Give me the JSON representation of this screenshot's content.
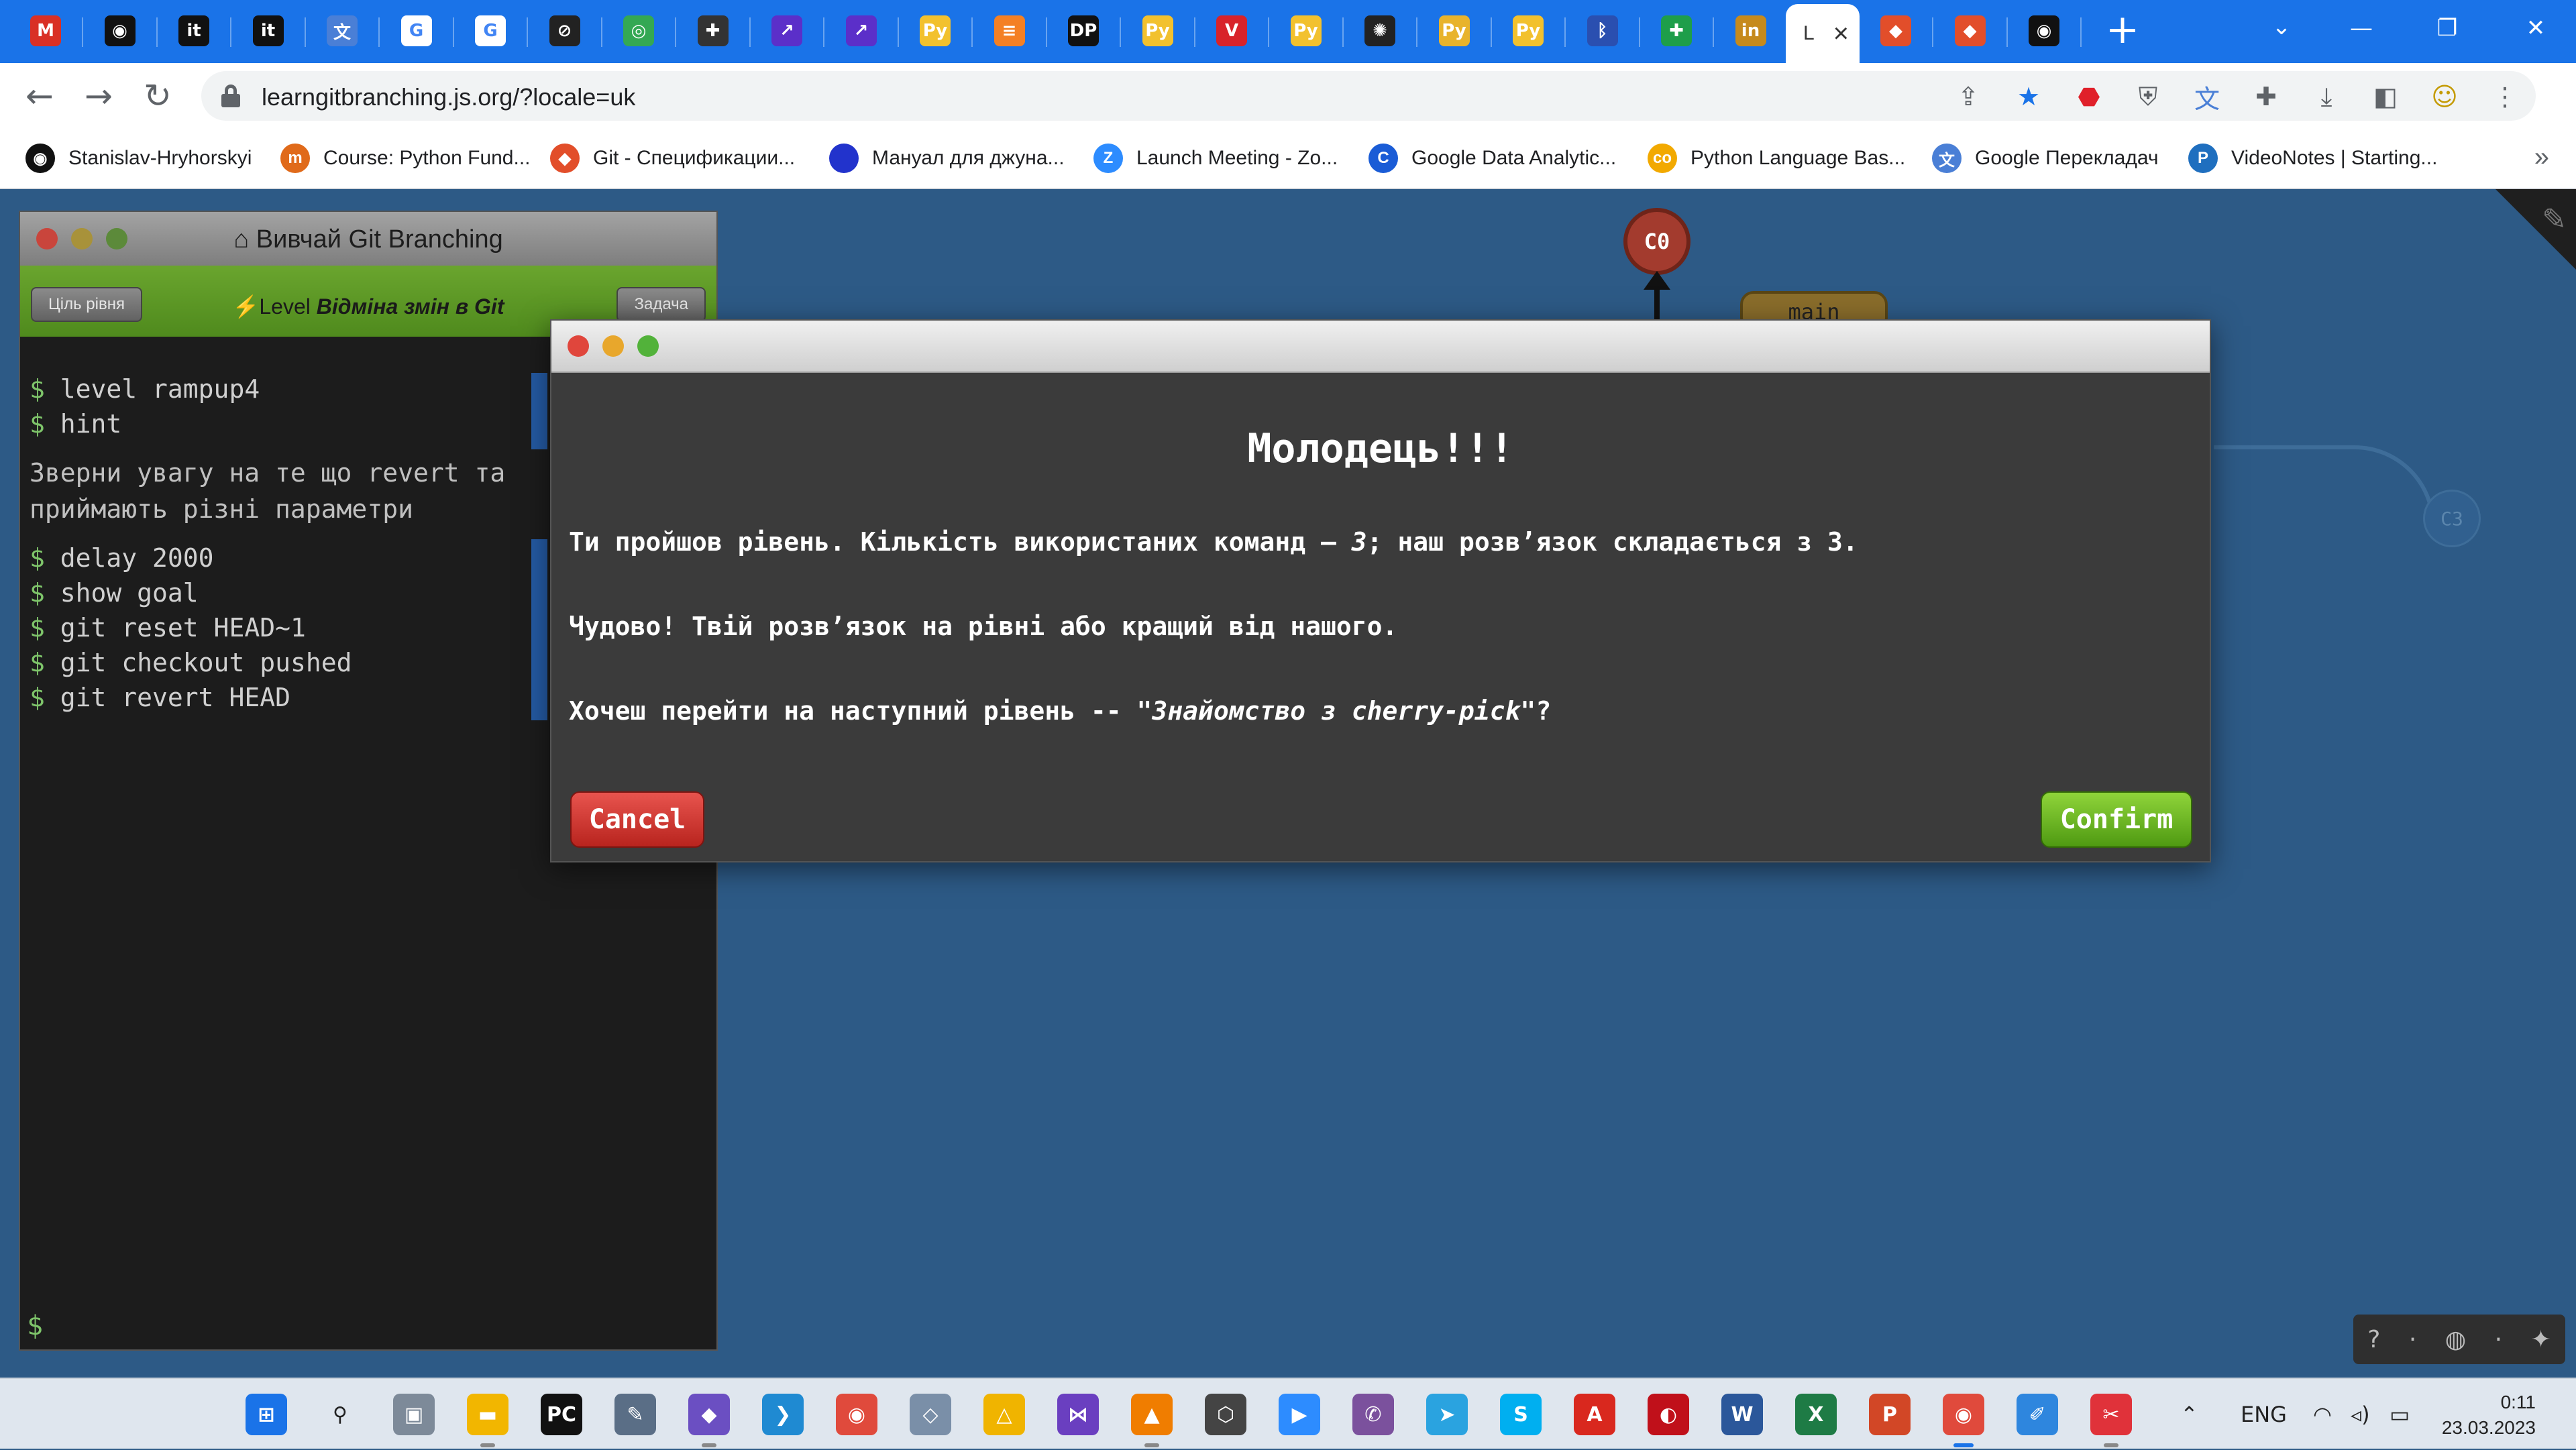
{
  "browser": {
    "tabs": [
      {
        "icon": "gmail-icon",
        "glyph": "M",
        "bg": "#d93025"
      },
      {
        "icon": "github-icon",
        "glyph": "◉",
        "bg": "#111111"
      },
      {
        "icon": "itproger-icon",
        "glyph": "it",
        "bg": "#111111"
      },
      {
        "icon": "itproger-icon",
        "glyph": "it",
        "bg": "#111111"
      },
      {
        "icon": "translate-icon",
        "glyph": "文",
        "bg": "#4a7fd6"
      },
      {
        "icon": "google-icon",
        "glyph": "G",
        "bg": "#ffffff"
      },
      {
        "icon": "google-icon",
        "glyph": "G",
        "bg": "#ffffff"
      },
      {
        "icon": "link-icon",
        "glyph": "⊘",
        "bg": "#222222"
      },
      {
        "icon": "chrome-web-icon",
        "glyph": "◎",
        "bg": "#34a853"
      },
      {
        "icon": "puzzle-icon",
        "glyph": "✚",
        "bg": "#333333"
      },
      {
        "icon": "visual-studio-icon",
        "glyph": "↗",
        "bg": "#5b2fc9"
      },
      {
        "icon": "visual-studio-icon",
        "glyph": "↗",
        "bg": "#5b2fc9"
      },
      {
        "icon": "python-icon",
        "glyph": "Py",
        "bg": "#f2c12e"
      },
      {
        "icon": "stackoverflow-icon",
        "glyph": "≡",
        "bg": "#f48024"
      },
      {
        "icon": "dp-icon",
        "glyph": "DP",
        "bg": "#111111"
      },
      {
        "icon": "python-icon",
        "glyph": "Py",
        "bg": "#f2c12e"
      },
      {
        "icon": "vivaldi-icon",
        "glyph": "V",
        "bg": "#d8232a"
      },
      {
        "icon": "python-icon",
        "glyph": "Py",
        "bg": "#f2c12e"
      },
      {
        "icon": "openai-icon",
        "glyph": "✺",
        "bg": "#222222"
      },
      {
        "icon": "python-icon",
        "glyph": "Py",
        "bg": "#e8b32c"
      },
      {
        "icon": "python-icon",
        "glyph": "Py",
        "bg": "#f2c12e"
      },
      {
        "icon": "bluetooth-icon",
        "glyph": "ᛒ",
        "bg": "#2a4fb0"
      },
      {
        "icon": "plus-cross-icon",
        "glyph": "✚",
        "bg": "#1e9e4a"
      },
      {
        "icon": "linkedin-icon",
        "glyph": "in",
        "bg": "#c68a1c"
      },
      {
        "icon": "git-icon",
        "glyph": "◆",
        "bg": "#e24e2a"
      },
      {
        "icon": "git-icon",
        "glyph": "◆",
        "bg": "#e24e2a"
      },
      {
        "icon": "github-icon",
        "glyph": "◉",
        "bg": "#111111"
      }
    ],
    "active_tab_label": "L",
    "new_tab": "+",
    "url": "learngitbranching.js.org/?locale=uk",
    "bookmarks": [
      {
        "label": "Stanislav-Hryhorskyi",
        "icon": "github-icon",
        "glyph": "◉",
        "color": "#111111"
      },
      {
        "label": "Course: Python Fund...",
        "icon": "course-icon",
        "glyph": "m",
        "color": "#e06a1a"
      },
      {
        "label": "Git - Спецификации...",
        "icon": "git-icon",
        "glyph": "◆",
        "color": "#e24e2a"
      },
      {
        "label": "Мануал для джуна...",
        "icon": "circle-icon",
        "glyph": "",
        "color": "#2233cc"
      },
      {
        "label": "Launch Meeting - Zo...",
        "icon": "zoom-icon",
        "glyph": "Z",
        "color": "#2d8cff"
      },
      {
        "label": "Google Data Analytic...",
        "icon": "coursera-icon",
        "glyph": "C",
        "color": "#1a5cd6"
      },
      {
        "label": "Python Language Bas...",
        "icon": "codecademy-icon",
        "glyph": "co",
        "color": "#f2a900"
      },
      {
        "label": "Google Перекладач",
        "icon": "translate-icon",
        "glyph": "文",
        "color": "#4a7fd6"
      },
      {
        "label": "VideoNotes | Starting...",
        "icon": "videonotes-icon",
        "glyph": "P",
        "color": "#1f6fbf"
      }
    ]
  },
  "terminal": {
    "title": "Вивчай Git Branching",
    "goal_button": "Ціль рівня",
    "task_button": "Задача",
    "level_prefix": "Level",
    "level_name": "Відміна змін в Git",
    "prompt_symbol": "$",
    "commands_before": [
      "level rampup4",
      "hint"
    ],
    "hint": "Зверни увагу на те що revert та приймають різні параметри",
    "commands_after": [
      "delay 2000",
      "show goal",
      "git reset HEAD~1",
      "git checkout pushed",
      "git revert HEAD"
    ]
  },
  "tree": {
    "commit_c0": "C0",
    "branch_main": "main",
    "commit_c3": "C3"
  },
  "modal": {
    "heading": "Молодець!!!",
    "line1_pre": "Ти пройшов рівень. Кількість використаних команд — ",
    "line1_num": "3",
    "line1_post": "; наш розв’язок складається з 3.",
    "line2": "Чудово! Твій розв’язок на рівні або кращий від нашого.",
    "line3_pre": "Хочеш перейти на наступний рівень -- ",
    "line3_level": "\"Знайомство з cherry-pick\"",
    "line3_post": "?",
    "cancel": "Cancel",
    "confirm": "Confirm"
  },
  "taskbar": {
    "apps": [
      {
        "icon": "windows-start-icon",
        "glyph": "⊞",
        "bg": "#1a73e8"
      },
      {
        "icon": "search-icon",
        "glyph": "⚲",
        "bg": "transparent"
      },
      {
        "icon": "task-view-icon",
        "glyph": "▣",
        "bg": "#7d8a99"
      },
      {
        "icon": "file-explorer-icon",
        "glyph": "▬",
        "bg": "#f2b600"
      },
      {
        "icon": "pycharm-icon",
        "glyph": "PC",
        "bg": "#111111"
      },
      {
        "icon": "notepad-icon",
        "glyph": "✎",
        "bg": "#5a6e86"
      },
      {
        "icon": "git-extensions-icon",
        "glyph": "◆",
        "bg": "#6b4fc2"
      },
      {
        "icon": "vscode-icon",
        "glyph": "❯",
        "bg": "#1f8ad2"
      },
      {
        "icon": "chrome-icon",
        "glyph": "◉",
        "bg": "#e04a3c"
      },
      {
        "icon": "sticky-app-icon",
        "glyph": "◇",
        "bg": "#7a8fa8"
      },
      {
        "icon": "alert-app-icon",
        "glyph": "△",
        "bg": "#f0b400"
      },
      {
        "icon": "visual-studio-icon",
        "glyph": "⋈",
        "bg": "#6a3fc0"
      },
      {
        "icon": "vlc-icon",
        "glyph": "▲",
        "bg": "#f07d00"
      },
      {
        "icon": "unity-icon",
        "glyph": "⬡",
        "bg": "#444444"
      },
      {
        "icon": "zoom-icon",
        "glyph": "▶",
        "bg": "#2d8cff"
      },
      {
        "icon": "viber-icon",
        "glyph": "✆",
        "bg": "#7b519d"
      },
      {
        "icon": "telegram-icon",
        "glyph": "➤",
        "bg": "#2aa3e0"
      },
      {
        "icon": "skype-icon",
        "glyph": "S",
        "bg": "#00aff0"
      },
      {
        "icon": "pdf-icon",
        "glyph": "A",
        "bg": "#d9281e"
      },
      {
        "icon": "media-icon",
        "glyph": "◐",
        "bg": "#c0101a"
      },
      {
        "icon": "word-icon",
        "glyph": "W",
        "bg": "#2b579a"
      },
      {
        "icon": "excel-icon",
        "glyph": "X",
        "bg": "#1e7b45"
      },
      {
        "icon": "powerpoint-icon",
        "glyph": "P",
        "bg": "#d24726"
      },
      {
        "icon": "chrome-icon",
        "glyph": "◉",
        "bg": "#e04a3c"
      },
      {
        "icon": "paint-icon",
        "glyph": "✐",
        "bg": "#2e86de"
      },
      {
        "icon": "snipping-icon",
        "glyph": "✂",
        "bg": "#e0323a"
      }
    ],
    "language": "ENG",
    "time": "0:11",
    "date": "23.03.2023"
  }
}
